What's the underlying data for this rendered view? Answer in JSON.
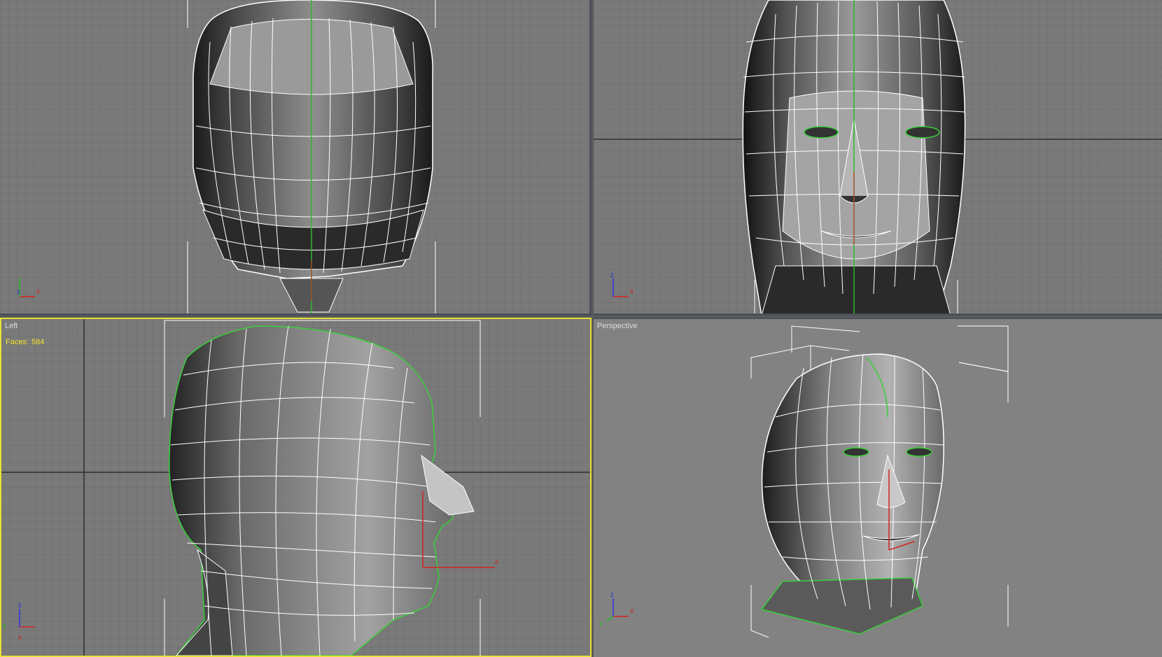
{
  "viewports": {
    "top": {
      "label": "",
      "axes": [
        "z",
        "x"
      ]
    },
    "front": {
      "label": "",
      "axes": [
        "z",
        "x"
      ]
    },
    "left": {
      "label": "Left",
      "active": true,
      "stats": {
        "faces_label": "Faces:",
        "faces_value": "584"
      },
      "axes": [
        "z",
        "y",
        "x"
      ]
    },
    "perspective": {
      "label": "Perspective",
      "axes": [
        "z",
        "y",
        "x"
      ]
    }
  },
  "colors": {
    "viewport_bg": "#7a7a7a",
    "grid_minor": "#6c6c6c",
    "grid_major": "#2c2c2c",
    "wire": "#ffffff",
    "selection": "#38d138",
    "active_border": "#e8e23a",
    "stat_text": "#f2e42a",
    "axis_x": "#d22222",
    "axis_y": "#22b922",
    "axis_z": "#3333dd"
  },
  "icons": {
    "gizmo": "transform-gizmo-icon",
    "axis_tripod": "axis-tripod-icon"
  }
}
